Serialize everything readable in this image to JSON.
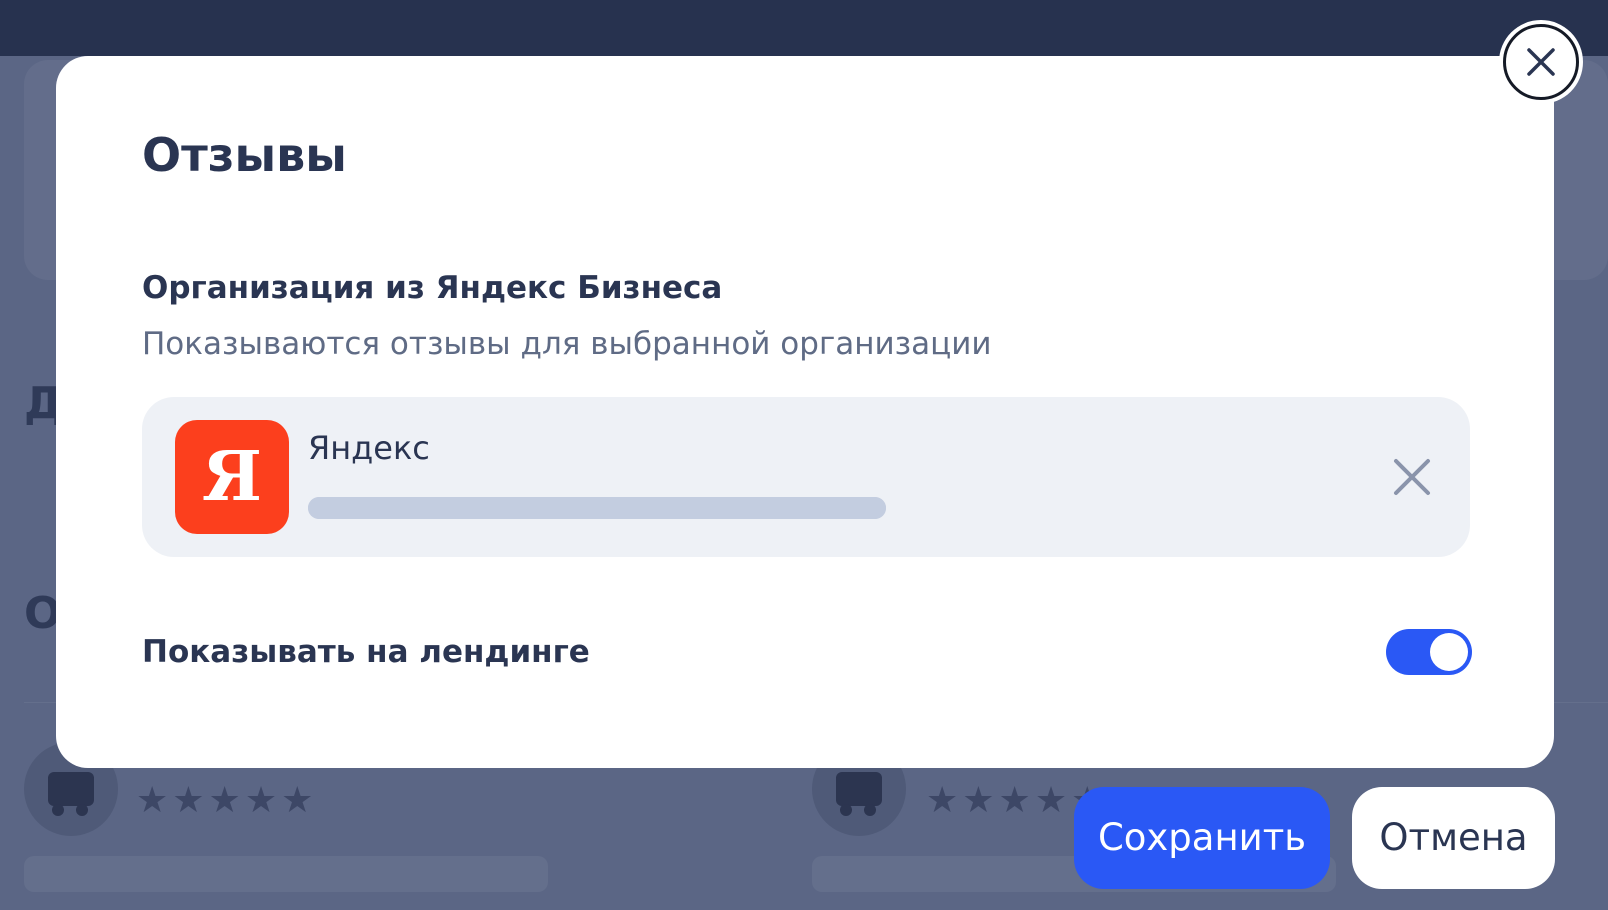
{
  "background": {
    "heading_1": "Д",
    "heading_2": "О",
    "stars": "★★★★★"
  },
  "modal": {
    "title": "Отзывы",
    "section_title": "Организация из Яндекс Бизнеса",
    "section_subtitle": "Показываются отзывы для выбранной организации",
    "organization": {
      "logo_letter": "Я",
      "name": "Яндекс",
      "logo_color": "#fc3f1d",
      "icon": "remove-icon"
    },
    "show_on_landing": {
      "label": "Показывать на лендинге",
      "enabled": true
    }
  },
  "footer": {
    "save_label": "Сохранить",
    "cancel_label": "Отмена"
  },
  "colors": {
    "accent": "#2a58f5",
    "text_primary": "#2a3552",
    "text_secondary": "#5f6b85"
  }
}
